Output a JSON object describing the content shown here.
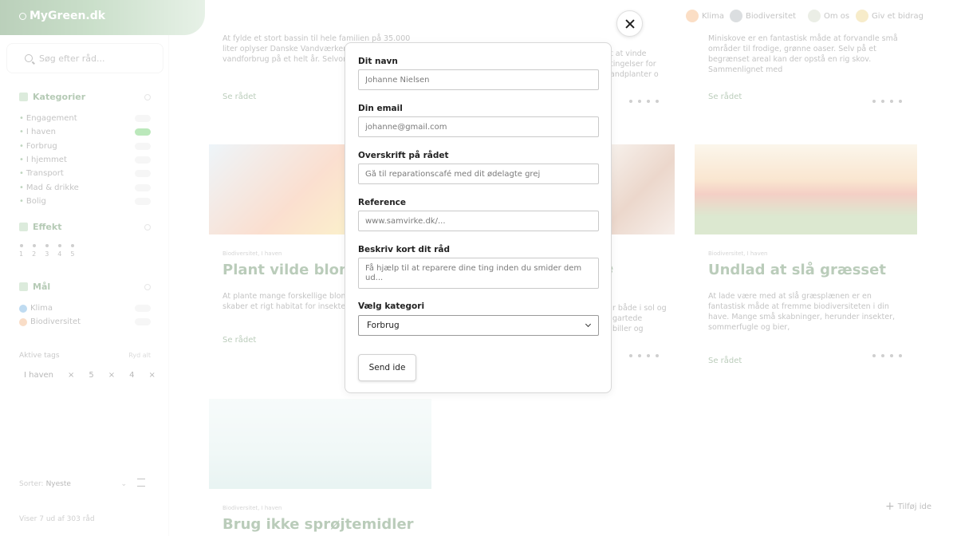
{
  "app": {
    "logo_text": "MyGreen.dk"
  },
  "nav": {
    "items": [
      {
        "label": "Klima",
        "color": "#f5a35c"
      },
      {
        "label": "Biodiversitet",
        "color": "#9aa3a8"
      },
      {
        "label": "Om os",
        "color": "#c8d1b8"
      },
      {
        "label": "Giv et bidrag",
        "color": "#e9c96b"
      }
    ]
  },
  "sidebar": {
    "search_placeholder": "Søg efter råd...",
    "categories_title": "Kategorier",
    "categories": [
      {
        "label": "Engagement",
        "active": false
      },
      {
        "label": "I haven",
        "active": true
      },
      {
        "label": "Forbrug",
        "active": false
      },
      {
        "label": "I hjemmet",
        "active": false
      },
      {
        "label": "Transport",
        "active": false
      },
      {
        "label": "Mad & drikke",
        "active": false
      },
      {
        "label": "Bolig",
        "active": false
      }
    ],
    "effect_title": "Effekt",
    "effect_levels": [
      "1",
      "2",
      "3",
      "4",
      "5"
    ],
    "goals_title": "Mål",
    "goals": [
      {
        "label": "Klima",
        "color": "#4a9bd8"
      },
      {
        "label": "Biodiversitet",
        "color": "#f0a060"
      }
    ],
    "active_tags_title": "Aktive tags",
    "clear_all": "Ryd alt",
    "tags": [
      "I haven",
      "×",
      "5",
      "×",
      "4",
      "×"
    ],
    "sort_label": "Sorter:",
    "sort_value": "Nyeste",
    "count_text": "Viser 7 ud af 303 råd"
  },
  "cards": [
    {
      "desc": "At fylde et stort bassin til hele familien på 35.000 liter oplyser Danske Vandværker, svarer til vandforbrug på et helt år. Selvom et",
      "link": "Se rådet"
    },
    {
      "desc": "Miniskove er en fantastisk måde at forvandle små områder til frodige, grønne oaser. Selv på et begrænset areal kan der opstå en rig skov. Sammenlignet med",
      "link": "Se rådet"
    },
    {
      "meta": "Biodiversitet, I haven",
      "title": "Plant vilde blomster",
      "desc": "At plante mange forskellige blomster på din altan skaber et rigt habitat for insekter og sommerfugle",
      "link": "Se rådet"
    },
    {
      "meta": "Biodiversitet, I haven",
      "title": "Undlad at slå græsset",
      "desc": "At lade være med at slå græsplænen er en fantastisk måde at fremme biodiversiteten i din have. Mange små skabninger, herunder insekter, sommerfugle og bier,",
      "link": "Se rådet"
    },
    {
      "meta": "Biodiversitet, I haven",
      "title": "Brug ikke sprøjtemidler"
    }
  ],
  "partial_text": {
    "mid_desc_1": "t at vinde",
    "mid_desc_2": "tingelser for",
    "mid_desc_3": "andplanter o",
    "mid_title": "e",
    "mid2_desc_1": "r både i sol og",
    "mid2_desc_2": "gartede",
    "mid2_desc_3": "biller og"
  },
  "add_button": "Tilføj ide",
  "modal": {
    "name_label": "Dit navn",
    "name_placeholder": "Johanne Nielsen",
    "email_label": "Din email",
    "email_placeholder": "johanne@gmail.com",
    "headline_label": "Overskrift på rådet",
    "headline_placeholder": "Gå til reparationscafé med dit ødelagte grej",
    "reference_label": "Reference",
    "reference_placeholder": "www.samvirke.dk/...",
    "description_label": "Beskriv kort dit råd",
    "description_placeholder": "Få hjælp til at reparere dine ting inden du smider dem ud...",
    "category_label": "Vælg kategori",
    "category_value": "Forbrug",
    "send_label": "Send ide"
  }
}
